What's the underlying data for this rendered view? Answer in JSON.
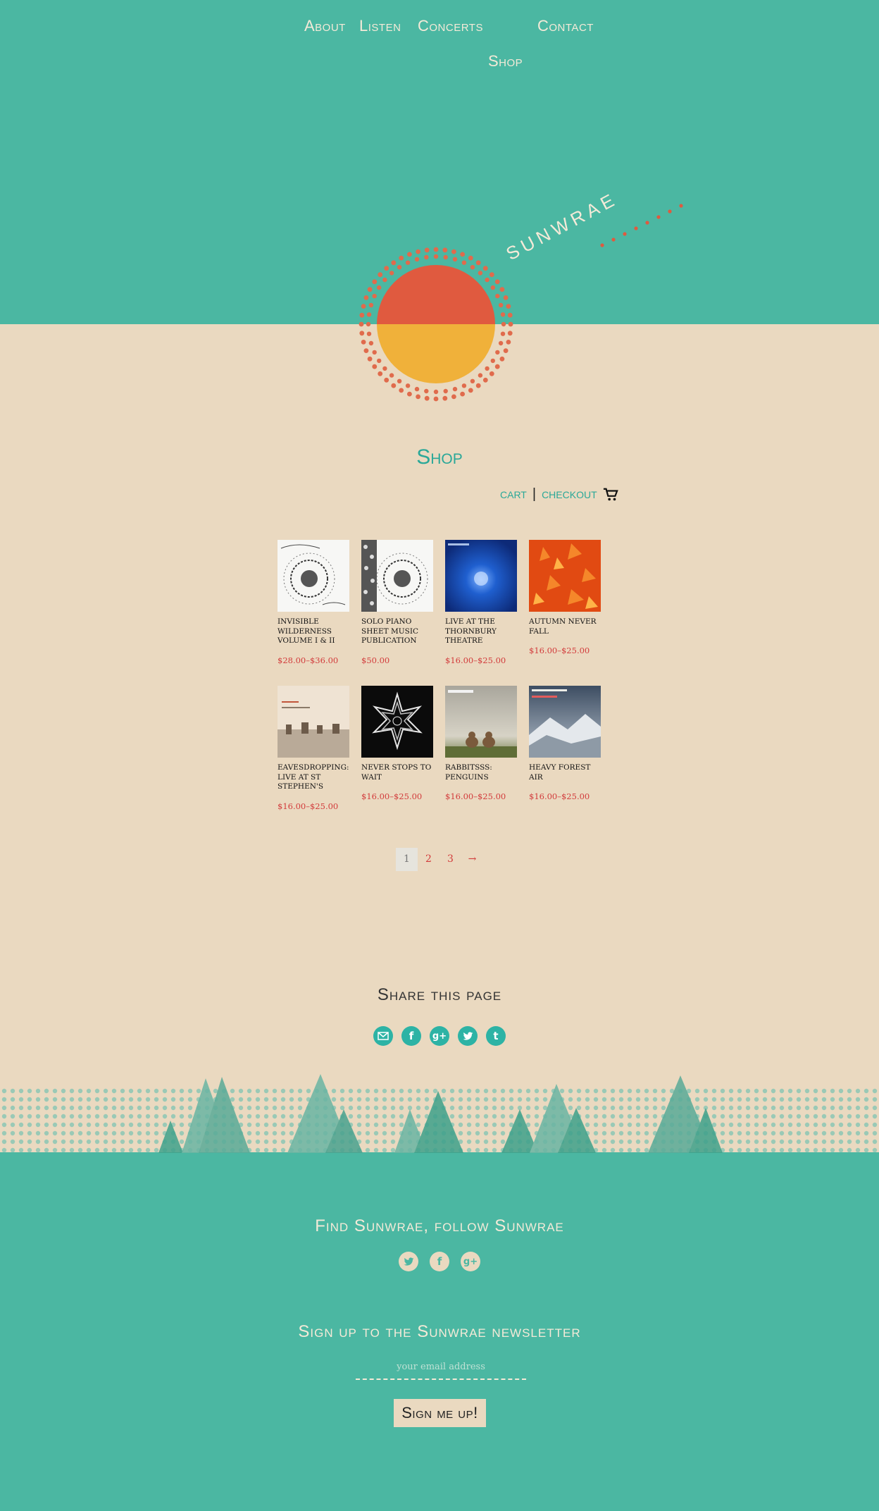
{
  "nav": {
    "about": "About",
    "listen": "Listen",
    "concerts": "Concerts",
    "contact": "Contact",
    "shop": "Shop"
  },
  "brand": {
    "name": "SUNWRAE"
  },
  "shop": {
    "title": "Shop",
    "cart": "cart",
    "separator": "|",
    "checkout": "checkout"
  },
  "products": [
    {
      "title": "INVISIBLE WILDERNESS VOLUME I & II",
      "price": "$28.00–$36.00"
    },
    {
      "title": "SOLO PIANO SHEET MUSIC PUBLICATION",
      "price": "$50.00"
    },
    {
      "title": "LIVE AT THE THORNBURY THEATRE",
      "price": "$16.00–$25.00"
    },
    {
      "title": "AUTUMN NEVER FALL",
      "price": "$16.00–$25.00"
    },
    {
      "title": "EAVESDROPPING: LIVE AT ST STEPHEN'S",
      "price": "$16.00–$25.00"
    },
    {
      "title": "NEVER STOPS TO WAIT",
      "price": "$16.00–$25.00"
    },
    {
      "title": "RABBITSSS: PENGUINS",
      "price": "$16.00–$25.00"
    },
    {
      "title": "HEAVY FOREST AIR",
      "price": "$16.00–$25.00"
    }
  ],
  "pagination": {
    "p1": "1",
    "p2": "2",
    "p3": "3",
    "next": "→"
  },
  "share": {
    "title": "Share this page",
    "icons": [
      "email-icon",
      "facebook-icon",
      "google-plus-icon",
      "twitter-icon",
      "tumblr-icon"
    ]
  },
  "follow": {
    "title": "Find Sunwrae, follow Sunwrae"
  },
  "newsletter": {
    "title": "Sign up to the Sunwrae newsletter",
    "placeholder": "your email address",
    "button": "Sign me up!"
  },
  "colors": {
    "teal": "#4bb7a2",
    "sand": "#ead9c0",
    "sun_red": "#e05a3f",
    "sun_yellow": "#f0b13a",
    "price_red": "#d23b3b",
    "link_teal": "#2aa898"
  }
}
